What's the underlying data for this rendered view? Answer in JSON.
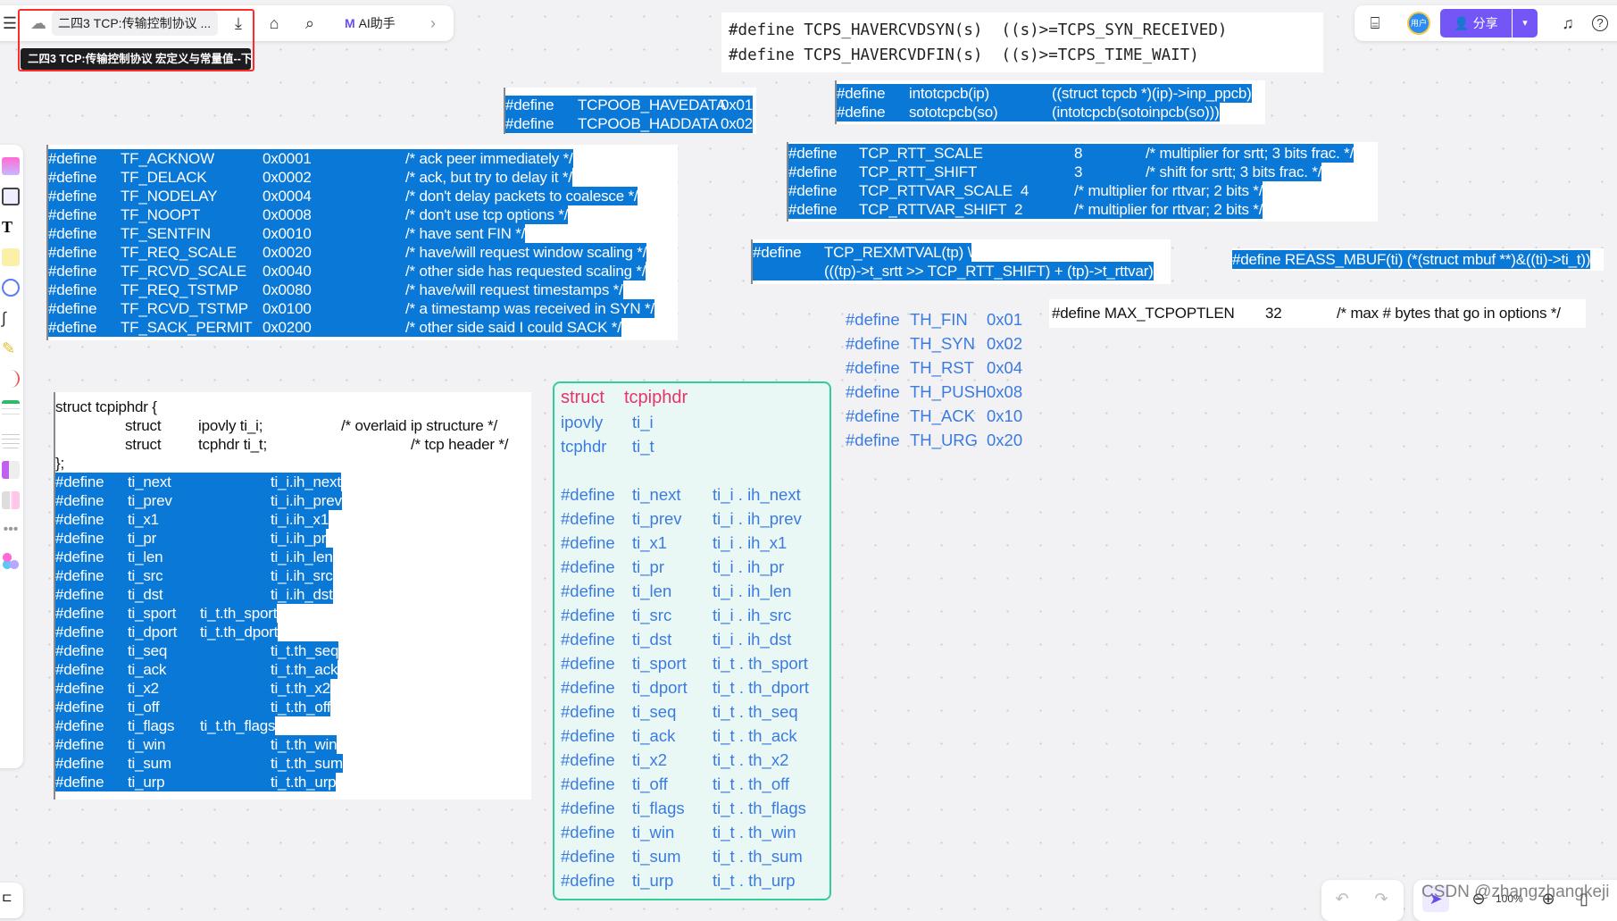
{
  "toolbar": {
    "doc_title": "二四3 TCP:传输控制协议 ...",
    "tooltip": "二四3 TCP:传输控制协议 宏定义与常量值--下",
    "ai_label": "AI助手",
    "share_label": "分享",
    "avatar_label": "用户",
    "icons": [
      "menu-icon",
      "cloud-sync-icon",
      "download-icon",
      "tag-icon",
      "search-icon",
      "ai-logo-icon",
      "chevron-right-icon",
      "toolbox-icon",
      "bell-icon",
      "help-icon"
    ]
  },
  "top_code": [
    "#define TCPS_HAVERCVDSYN(s)  ((s)>=TCPS_SYN_RECEIVED)",
    "#define TCPS_HAVERCVDFIN(s)  ((s)>=TCPS_TIME_WAIT)"
  ],
  "tcpoob": [
    [
      "#define",
      "TCPOOB_HAVEDATA",
      "0x01"
    ],
    [
      "#define",
      "TCPOOB_HADDATA",
      "0x02"
    ]
  ],
  "intotcpcb": [
    [
      "#define",
      "intotcpcb(ip)",
      "((struct tcpcb *)(ip)->inp_ppcb)"
    ],
    [
      "#define",
      "sototcpcb(so)",
      "(intotcpcb(sotoinpcb(so)))"
    ]
  ],
  "tf_flags": [
    [
      "#define",
      "TF_ACKNOW",
      "0x0001",
      "/* ack peer immediately */"
    ],
    [
      "#define",
      "TF_DELACK",
      "0x0002",
      "/* ack, but try to delay it */"
    ],
    [
      "#define",
      "TF_NODELAY",
      "0x0004",
      "/* don't delay packets to coalesce */"
    ],
    [
      "#define",
      "TF_NOOPT",
      "0x0008",
      "/* don't use tcp options */"
    ],
    [
      "#define",
      "TF_SENTFIN",
      "0x0010",
      "/* have sent FIN */"
    ],
    [
      "#define",
      "TF_REQ_SCALE",
      "0x0020",
      "/* have/will request window scaling */"
    ],
    [
      "#define",
      "TF_RCVD_SCALE",
      "0x0040",
      "/* other side has requested scaling */"
    ],
    [
      "#define",
      "TF_REQ_TSTMP",
      "0x0080",
      "/* have/will request timestamps */"
    ],
    [
      "#define",
      "TF_RCVD_TSTMP",
      "0x0100",
      "/* a timestamp was received in SYN */"
    ],
    [
      "#define",
      "TF_SACK_PERMIT",
      "0x0200",
      "/* other side said I could SACK */"
    ]
  ],
  "rtt": [
    [
      "#define",
      "TCP_RTT_SCALE",
      "8",
      "/* multiplier for srtt; 3 bits frac. */"
    ],
    [
      "#define",
      "TCP_RTT_SHIFT",
      "3",
      "/* shift for srtt; 3 bits frac. */"
    ],
    [
      "#define",
      "TCP_RTTVAR_SCALE  4",
      "",
      "/* multiplier for rttvar; 2 bits */"
    ],
    [
      "#define",
      "TCP_RTTVAR_SHIFT  2",
      "",
      "/* multiplier for rttvar; 2 bits */"
    ]
  ],
  "rexmtval": [
    [
      "#define",
      "TCP_REXMTVAL(tp) \\"
    ],
    [
      "",
      "(((tp)->t_srtt >> TCP_RTT_SHIFT) + (tp)->t_rttvar)"
    ]
  ],
  "reass": "#define REASS_MBUF(ti) (*(struct mbuf **)&((ti)->ti_t))",
  "maxopt": [
    "#define MAX_TCPOPTLEN",
    "32",
    "/* max # bytes that go in options */"
  ],
  "th_flags": [
    [
      "#define",
      "TH_FIN",
      "0x01"
    ],
    [
      "#define",
      "TH_SYN",
      "0x02"
    ],
    [
      "#define",
      "TH_RST",
      "0x04"
    ],
    [
      "#define",
      "TH_PUSH",
      "0x08"
    ],
    [
      "#define",
      "TH_ACK",
      "0x10"
    ],
    [
      "#define",
      "TH_URG",
      "0x20"
    ]
  ],
  "tcpiphdr_struct": [
    [
      "struct tcpiphdr {",
      "",
      ""
    ],
    [
      "struct",
      "ipovly ti_i;",
      "/* overlaid ip structure */"
    ],
    [
      "struct",
      "tcphdr ti_t;",
      "/* tcp header */"
    ],
    [
      "};",
      "",
      ""
    ]
  ],
  "tcpiphdr_defines": [
    [
      "#define",
      "ti_next",
      "ti_i.ih_next"
    ],
    [
      "#define",
      "ti_prev",
      "ti_i.ih_prev"
    ],
    [
      "#define",
      "ti_x1",
      "ti_i.ih_x1"
    ],
    [
      "#define",
      "ti_pr",
      "ti_i.ih_pr"
    ],
    [
      "#define",
      "ti_len",
      "ti_i.ih_len"
    ],
    [
      "#define",
      "ti_src",
      "ti_i.ih_src"
    ],
    [
      "#define",
      "ti_dst",
      "ti_i.ih_dst"
    ],
    [
      "#define",
      "ti_sport",
      "ti_t.th_sport"
    ],
    [
      "#define",
      "ti_dport",
      "ti_t.th_dport"
    ],
    [
      "#define",
      "ti_seq",
      "ti_t.th_seq"
    ],
    [
      "#define",
      "ti_ack",
      "ti_t.th_ack"
    ],
    [
      "#define",
      "ti_x2",
      "ti_t.th_x2"
    ],
    [
      "#define",
      "ti_off",
      "ti_t.th_off"
    ],
    [
      "#define",
      "ti_flags",
      "ti_t.th_flags"
    ],
    [
      "#define",
      "ti_win",
      "ti_t.th_win"
    ],
    [
      "#define",
      "ti_sum",
      "ti_t.th_sum"
    ],
    [
      "#define",
      "ti_urp",
      "ti_t.th_urp"
    ]
  ],
  "note": {
    "title": [
      "struct",
      "tcpiphdr"
    ],
    "members": [
      [
        "ipovly",
        "ti_i"
      ],
      [
        "tcphdr",
        "ti_t"
      ]
    ],
    "defines": [
      [
        "#define",
        "ti_next",
        "ti_i . ih_next"
      ],
      [
        "#define",
        "ti_prev",
        "ti_i . ih_prev"
      ],
      [
        "#define",
        "ti_x1",
        "ti_i . ih_x1"
      ],
      [
        "#define",
        "ti_pr",
        "ti_i . ih_pr"
      ],
      [
        "#define",
        "ti_len",
        "ti_i . ih_len"
      ],
      [
        "#define",
        "ti_src",
        "ti_i . ih_src"
      ],
      [
        "#define",
        "ti_dst",
        "ti_i . ih_dst"
      ],
      [
        "#define",
        "ti_sport",
        "ti_t . th_sport"
      ],
      [
        "#define",
        "ti_dport",
        "ti_t . th_dport"
      ],
      [
        "#define",
        "ti_seq",
        "ti_t . th_seq"
      ],
      [
        "#define",
        "ti_ack",
        "ti_t . th_ack"
      ],
      [
        "#define",
        "ti_x2",
        "ti_t . th_x2"
      ],
      [
        "#define",
        "ti_off",
        "ti_t . th_off"
      ],
      [
        "#define",
        "ti_flags",
        "ti_t . th_flags"
      ],
      [
        "#define",
        "ti_win",
        "ti_t . th_win"
      ],
      [
        "#define",
        "ti_sum",
        "ti_t . th_sum"
      ],
      [
        "#define",
        "ti_urp",
        "ti_t . th_urp"
      ]
    ]
  },
  "bottom": {
    "watermark": "CSDN @zhangzhangkeji",
    "zoom": "100%"
  },
  "colors": {
    "selection": "#0a78d7",
    "accent": "#7356f5",
    "note_border": "#2fcf96",
    "note_bg": "#e9f8f4",
    "note_title": "#e8336b",
    "note_text": "#3b7be0",
    "highlight_box": "#ff2a2a"
  }
}
